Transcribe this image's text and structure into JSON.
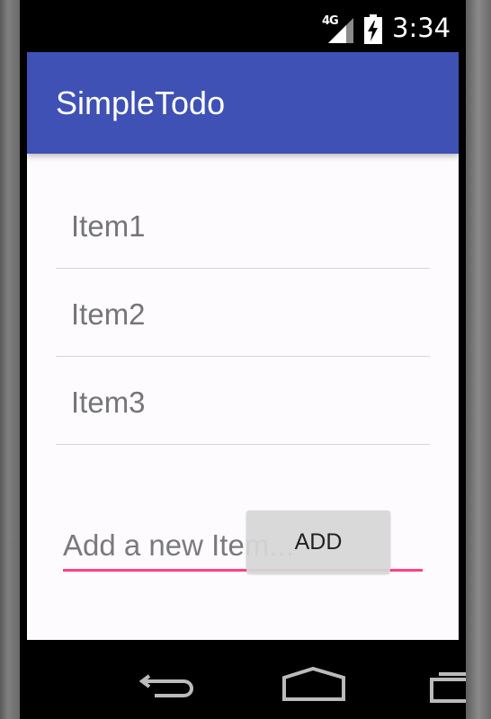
{
  "status_bar": {
    "network": "4G",
    "time": "3:34"
  },
  "app_bar": {
    "title": "SimpleTodo"
  },
  "todo_list": {
    "items": [
      {
        "label": "Item1"
      },
      {
        "label": "Item2"
      },
      {
        "label": "Item3"
      }
    ]
  },
  "new_item": {
    "placeholder": "Add a new Item...",
    "value": ""
  },
  "add_button": {
    "label": "ADD"
  },
  "colors": {
    "primary": "#3f51b5",
    "accent": "#ff4081",
    "background": "#fdfbfe"
  },
  "nav_bar": {
    "icons": [
      "back-icon",
      "home-icon",
      "recents-icon"
    ]
  }
}
